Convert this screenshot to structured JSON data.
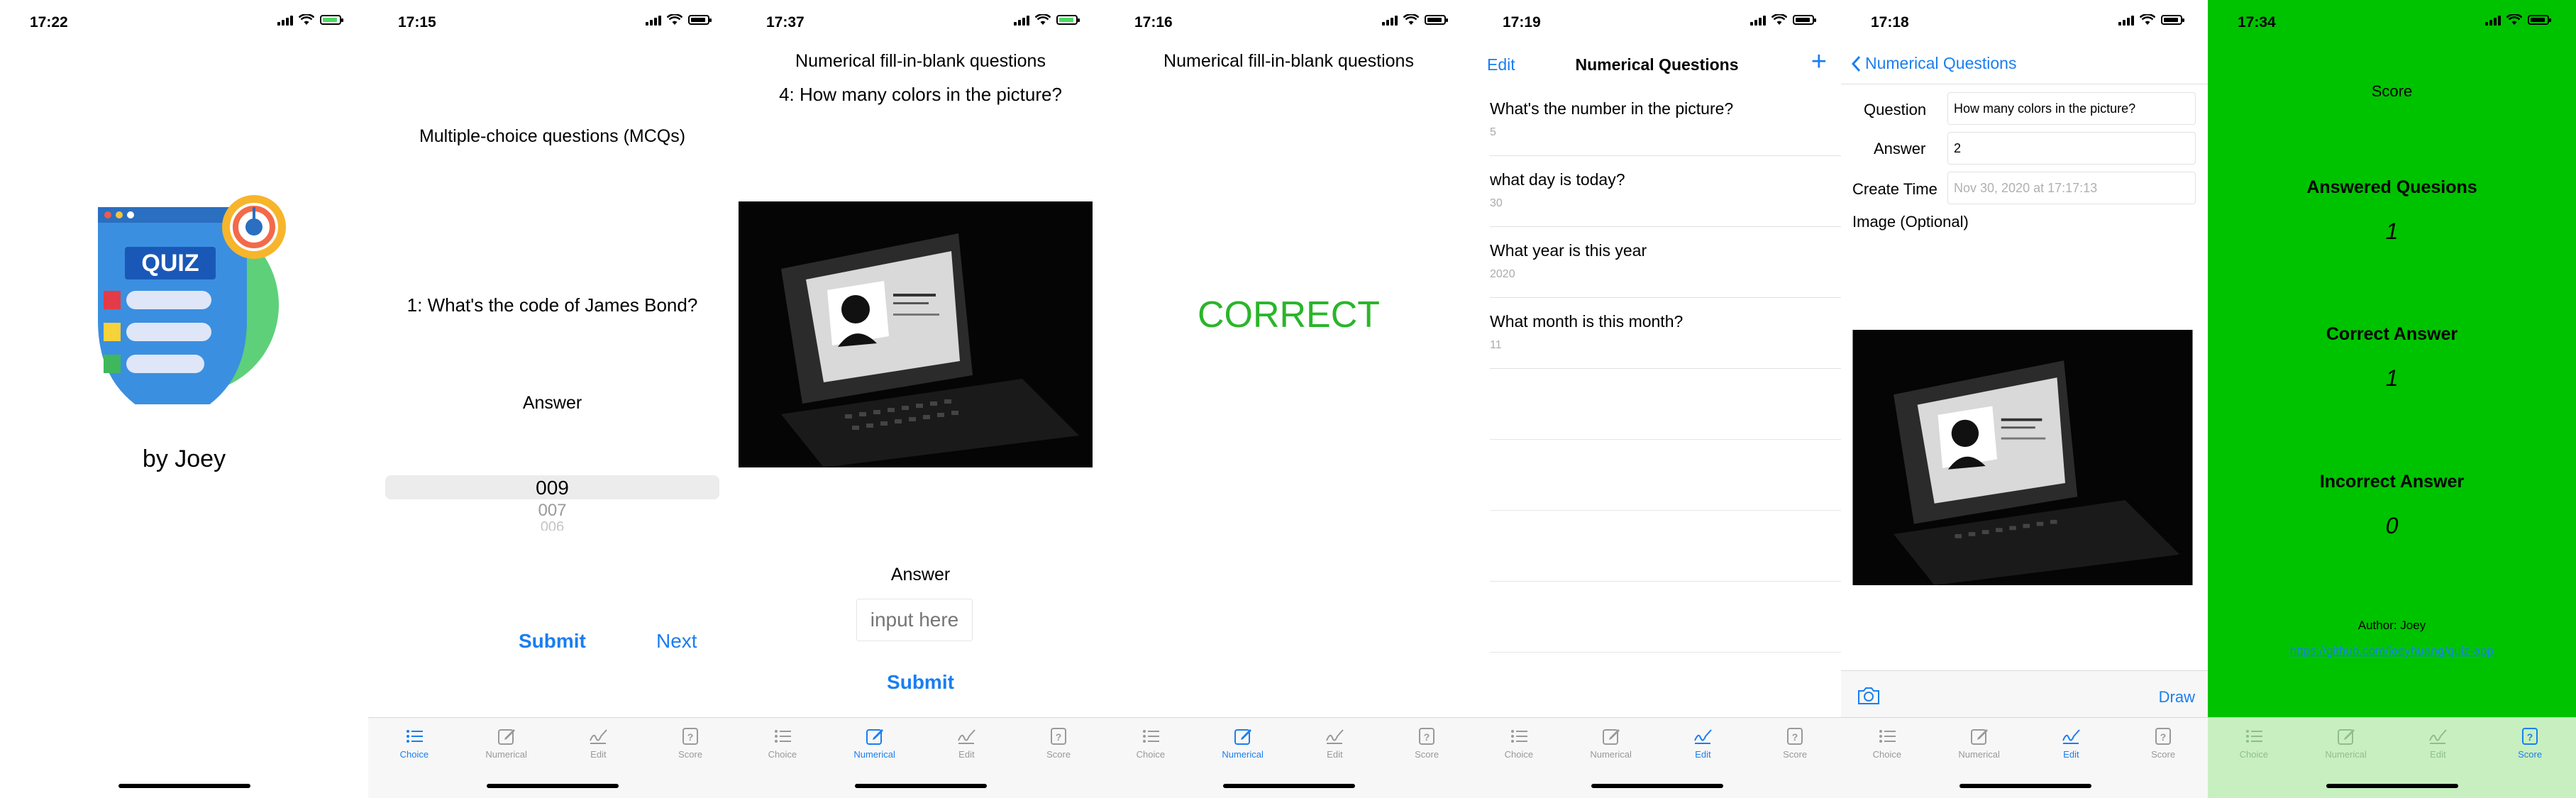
{
  "tabs": [
    {
      "label": "Choice",
      "icon": "list-icon"
    },
    {
      "label": "Numerical",
      "icon": "edit-square-icon"
    },
    {
      "label": "Edit",
      "icon": "signature-icon"
    },
    {
      "label": "Score",
      "icon": "question-square-icon"
    }
  ],
  "screen1": {
    "time": "17:22",
    "author": "by Joey",
    "logo_text": "QUIZ"
  },
  "screen2": {
    "time": "17:15",
    "title": "Multiple-choice questions (MCQs)",
    "question": "1: What's the code of James Bond?",
    "answer_label": "Answer",
    "picker": [
      "009",
      "007",
      "006"
    ],
    "submit": "Submit",
    "next": "Next"
  },
  "screen3": {
    "time": "17:37",
    "title": "Numerical fill-in-blank questions",
    "question": "4: How many colors in the picture?",
    "answer_label": "Answer",
    "placeholder": "input here",
    "submit": "Submit"
  },
  "screen4": {
    "time": "17:16",
    "title": "Numerical fill-in-blank questions",
    "result": "CORRECT"
  },
  "screen5": {
    "time": "17:19",
    "edit": "Edit",
    "title": "Numerical Questions",
    "items": [
      {
        "q": "What's the number in the picture?",
        "a": "5"
      },
      {
        "q": "what day is today?",
        "a": "30"
      },
      {
        "q": "What year is this year",
        "a": "2020"
      },
      {
        "q": "What month is this month?",
        "a": "11"
      }
    ]
  },
  "screen6": {
    "time": "17:18",
    "back": "Numerical Questions",
    "question_label": "Question",
    "question_value": "How many colors in the picture?",
    "answer_label": "Answer",
    "answer_value": "2",
    "create_label": "Create Time",
    "create_value": "Nov 30, 2020 at 17:17:13",
    "image_label": "Image (Optional)",
    "draw": "Draw"
  },
  "screen7": {
    "time": "17:34",
    "title": "Score",
    "answered_label": "Answered Quesions",
    "answered_value": "1",
    "correct_label": "Correct Answer",
    "correct_value": "1",
    "incorrect_label": "Incorrect Answer",
    "incorrect_value": "0",
    "author": "Author: Joey",
    "link": "https://github.com/joeyhuang/quiz-app"
  },
  "colors": {
    "accent": "#1a7ef0",
    "correct": "#2ab52a",
    "score_bg": "#00c300"
  }
}
